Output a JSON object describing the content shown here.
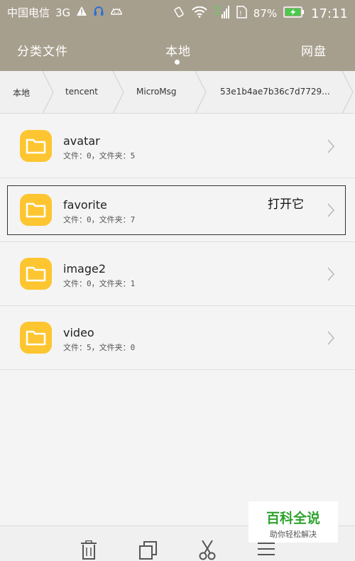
{
  "status_bar": {
    "carrier": "中国电信",
    "network": "3G",
    "network_icons": [
      "warning-icon",
      "headset-icon",
      "android-icon"
    ],
    "right_icons": [
      "vibrate-icon",
      "wifi-icon",
      "signal-3g-icon",
      "sim-icon"
    ],
    "battery": "87%",
    "time": "17:11"
  },
  "tabs": [
    {
      "label": "分类文件",
      "active": false
    },
    {
      "label": "本地",
      "active": true
    },
    {
      "label": "网盘",
      "active": false
    }
  ],
  "breadcrumb": [
    "本地",
    "tencent",
    "MicroMsg",
    "53e1b4ae7b36c7d7729..."
  ],
  "files": [
    {
      "name": "avatar",
      "meta": "文件：0，文件夹：5",
      "icon": "folder-icon"
    },
    {
      "name": "favorite",
      "meta": "文件：0，文件夹：7",
      "icon": "folder-icon",
      "selected": true,
      "action_label": "打开它"
    },
    {
      "name": "image2",
      "meta": "文件：0，文件夹：1",
      "icon": "folder-icon"
    },
    {
      "name": "video",
      "meta": "文件：5，文件夹：0",
      "icon": "folder-icon"
    }
  ],
  "toolbar": [
    "delete-icon",
    "copy-icon",
    "cut-icon",
    "menu-icon"
  ],
  "watermark": {
    "title": "百科全说",
    "subtitle": "助你轻松解决"
  },
  "colors": {
    "header": "#a79f8e",
    "folder": "#fdc631",
    "watermark_green": "#2ea42e"
  }
}
